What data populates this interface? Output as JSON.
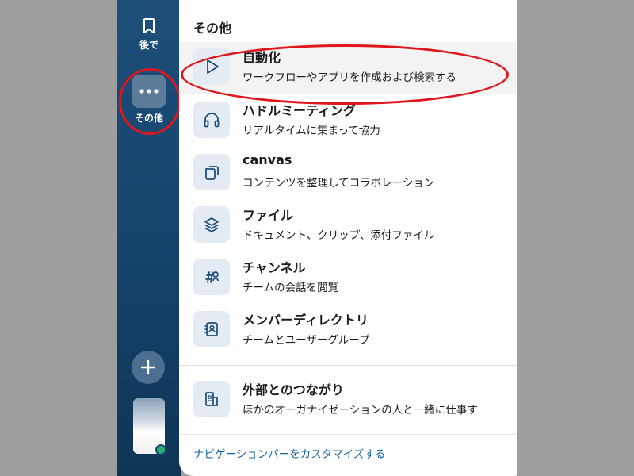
{
  "sidebar": {
    "later_label": "後で",
    "more_label": "その他",
    "later_icon": "bookmark-icon",
    "more_icon": "ellipsis-icon",
    "add_icon": "plus-icon"
  },
  "panel": {
    "title": "その他",
    "items": [
      {
        "title": "自動化",
        "subtitle": "ワークフローやアプリを作成および検索する",
        "icon": "play-icon"
      },
      {
        "title": "ハドルミーティング",
        "subtitle": "リアルタイムに集まって協力",
        "icon": "headphones-icon"
      },
      {
        "title": "canvas",
        "subtitle": "コンテンツを整理してコラボレーション",
        "icon": "canvas-icon"
      },
      {
        "title": "ファイル",
        "subtitle": "ドキュメント、クリップ、添付ファイル",
        "icon": "layers-icon"
      },
      {
        "title": "チャンネル",
        "subtitle": "チームの会話を閲覧",
        "icon": "channel-search-icon"
      },
      {
        "title": "メンバーディレクトリ",
        "subtitle": "チームとユーザーグループ",
        "icon": "contact-book-icon"
      }
    ],
    "external": {
      "title": "外部とのつながり",
      "subtitle": "ほかのオーガナイゼーションの人と一緒に仕事す",
      "icon": "building-icon"
    },
    "customize_link": "ナビゲーションバーをカスタマイズする"
  },
  "colors": {
    "sidebar": "#17466f",
    "annotation_ring": "#e0161d",
    "link": "#1264a3",
    "presence": "#2bac76"
  }
}
